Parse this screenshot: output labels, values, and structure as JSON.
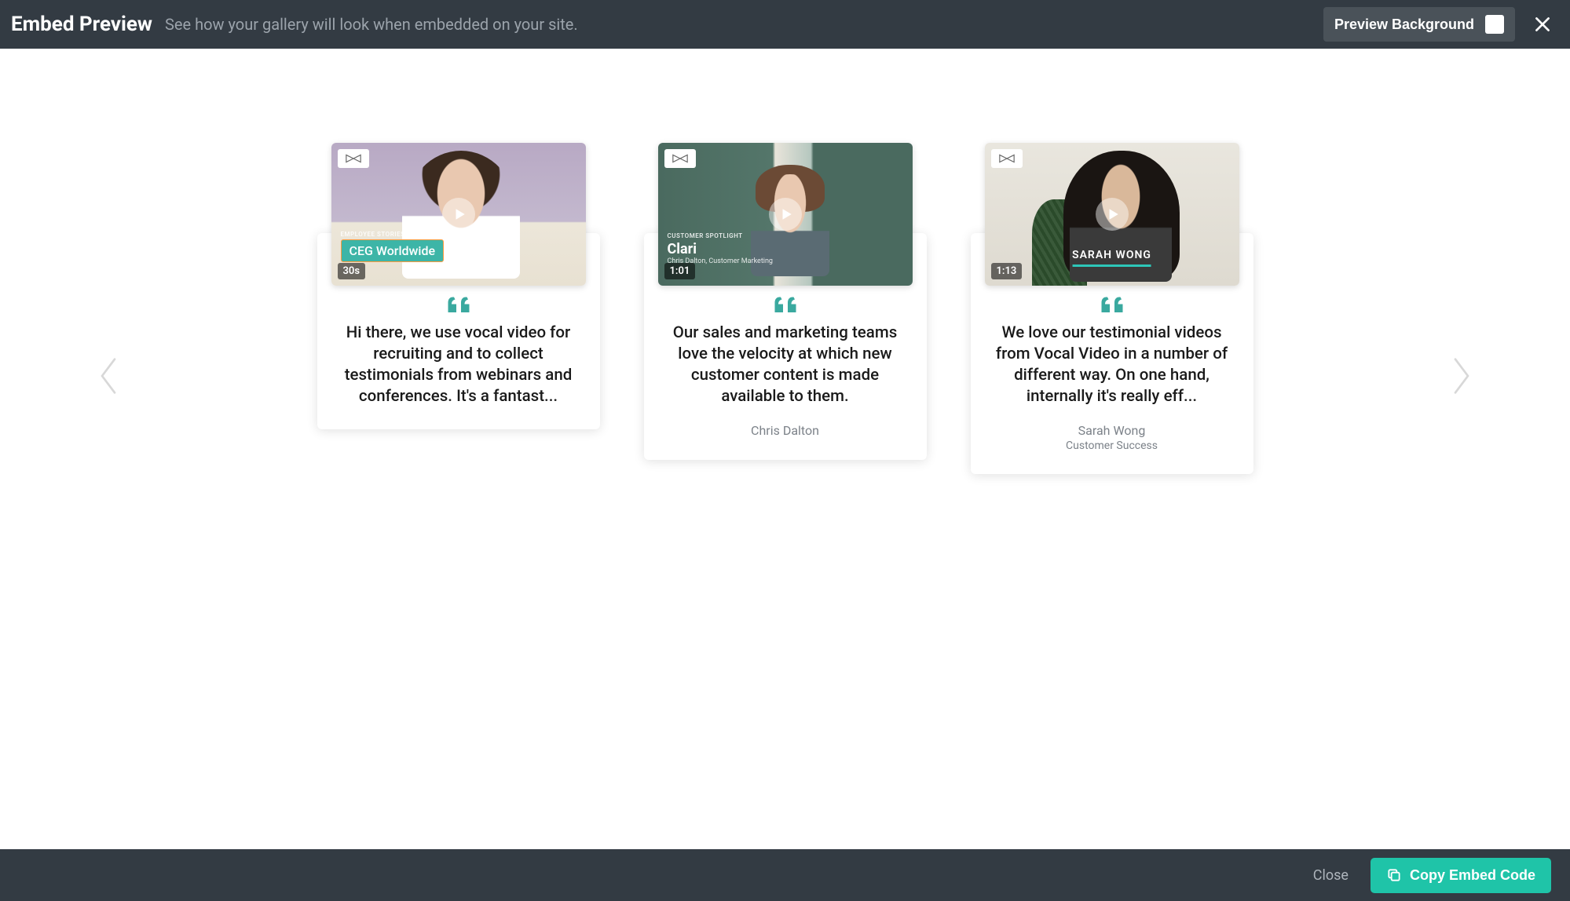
{
  "header": {
    "title": "Embed Preview",
    "subtitle": "See how your gallery will look when embedded on your site.",
    "preview_bg_label": "Preview Background"
  },
  "cards": [
    {
      "duration": "30s",
      "overlay_super": "EMPLOYEE STORIES",
      "overlay_title": "CEG Worldwide",
      "quote": "Hi there, we use vocal video for recruiting and to collect testimonials from webinars and conferences. It's a fantast..."
    },
    {
      "duration": "1:01",
      "overlay_super": "CUSTOMER SPOTLIGHT",
      "overlay_title": "Clari",
      "overlay_sub": "Chris Dalton, Customer Marketing",
      "quote": "Our sales and marketing teams love the velocity at which new customer content is made available to them.",
      "attribution_name": "Chris Dalton"
    },
    {
      "duration": "1:13",
      "overlay_name": "SARAH WONG",
      "quote": "We love our testimonial videos from Vocal Video in a number of different way. On one hand, internally it's really eff...",
      "attribution_name": "Sarah Wong",
      "attribution_role": "Customer Success"
    }
  ],
  "footer": {
    "close_label": "Close",
    "copy_label": "Copy Embed Code"
  },
  "colors": {
    "accent": "#1fc4a8",
    "header_bg": "#333b43",
    "quote_icon": "#3aa99f"
  }
}
